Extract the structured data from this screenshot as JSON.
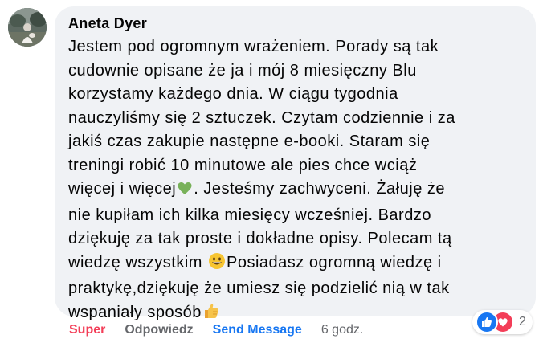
{
  "comment": {
    "author": "Aneta Dyer",
    "lines": [
      "Jestem pod ogromnym wrażeniem. Porady są tak",
      "cudownie opisane że ja i mój 8 miesięczny Blu",
      "korzystamy każdego dnia. W ciągu tygodnia",
      "nauczyliśmy się 2 sztuczek. Czytam codziennie i za",
      "jakiś czas zakupie następne e-booki. Staram się",
      "treningi robić 10 minutowe ale pies chce wciąż"
    ],
    "line7_before": "więcej i więcej",
    "line7_after": ". Jesteśmy zachwyceni. Żałuję że",
    "lines_mid": [
      "nie kupiłam ich kilka miesięcy wcześniej. Bardzo",
      "dziękuję za tak proste i dokładne opisy. Polecam tą"
    ],
    "line10_before": "wiedzę wszystkim ",
    "line10_after": "Posiadasz ogromną wiedzę i",
    "line11": "praktykę,dziękuję że umiesz się podzielić nią w tak",
    "line12_before": "wspaniały sposób",
    "emojis": {
      "green_heart": "green-heart-emoji",
      "grinning": "grinning-face-emoji",
      "thumbs_up": "thumbs-up-emoji"
    }
  },
  "actions": {
    "super_label": "Super",
    "reply_label": "Odpowiedz",
    "send_label": "Send Message",
    "timestamp": "6 godz."
  },
  "reactions": {
    "count": "2",
    "types": [
      "like-icon",
      "love-icon"
    ]
  },
  "colors": {
    "bubble": "#f0f2f5",
    "text": "#050505",
    "secondary": "#65676b",
    "love": "#f33e58",
    "brand": "#1877f2"
  }
}
